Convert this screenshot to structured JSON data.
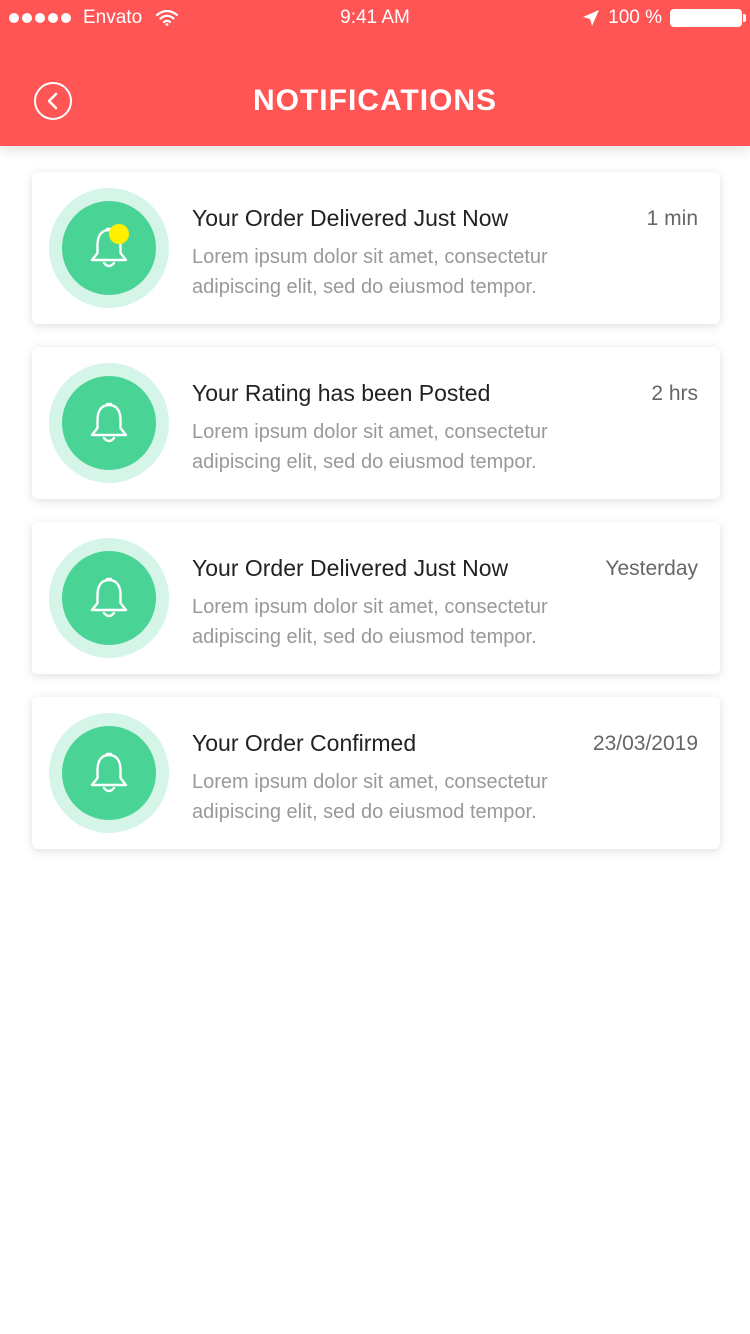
{
  "status_bar": {
    "carrier": "Envato",
    "time": "9:41 AM",
    "battery": "100 %"
  },
  "header": {
    "title": "NOTIFICATIONS",
    "background_color": "#ff5555"
  },
  "notifications": [
    {
      "title": "Your Order Delivered Just Now",
      "time": "1 min",
      "body": "Lorem ipsum dolor sit amet, consectetur adipiscing elit, sed do eiusmod tempor.",
      "icon": "bell-icon",
      "unread": true
    },
    {
      "title": "Your Rating has been Posted",
      "time": "2 hrs",
      "body": "Lorem ipsum dolor sit amet, consectetur adipiscing elit, sed do eiusmod tempor.",
      "icon": "bell-icon",
      "unread": false
    },
    {
      "title": "Your Order Delivered Just Now",
      "time": "Yesterday",
      "body": "Lorem ipsum dolor sit amet, consectetur adipiscing elit, sed do eiusmod tempor.",
      "icon": "bell-icon",
      "unread": false
    },
    {
      "title": "Your Order Confirmed",
      "time": "23/03/2019",
      "body": "Lorem ipsum dolor sit amet, consectetur adipiscing elit, sed do eiusmod tempor.",
      "icon": "bell-icon",
      "unread": false
    }
  ],
  "colors": {
    "accent": "#ff5555",
    "icon_green": "#49d495",
    "icon_ring": "#d5f5e8",
    "unread_badge": "#fff000"
  }
}
